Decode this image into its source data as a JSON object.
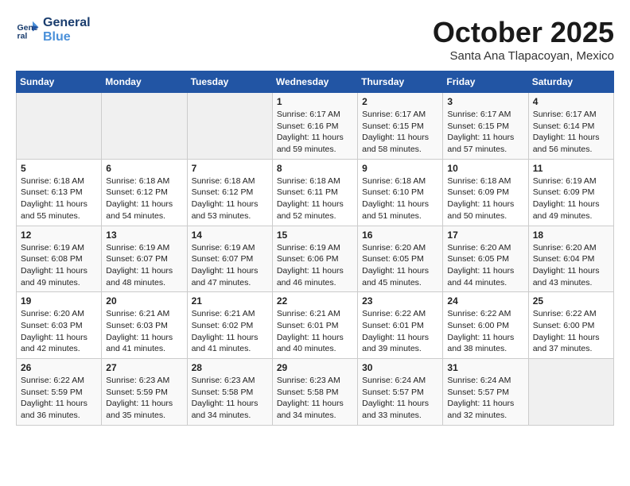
{
  "header": {
    "logo_line1": "General",
    "logo_line2": "Blue",
    "month": "October 2025",
    "location": "Santa Ana Tlapacoyan, Mexico"
  },
  "weekdays": [
    "Sunday",
    "Monday",
    "Tuesday",
    "Wednesday",
    "Thursday",
    "Friday",
    "Saturday"
  ],
  "weeks": [
    [
      {
        "day": "",
        "info": ""
      },
      {
        "day": "",
        "info": ""
      },
      {
        "day": "",
        "info": ""
      },
      {
        "day": "1",
        "info": "Sunrise: 6:17 AM\nSunset: 6:16 PM\nDaylight: 11 hours\nand 59 minutes."
      },
      {
        "day": "2",
        "info": "Sunrise: 6:17 AM\nSunset: 6:15 PM\nDaylight: 11 hours\nand 58 minutes."
      },
      {
        "day": "3",
        "info": "Sunrise: 6:17 AM\nSunset: 6:15 PM\nDaylight: 11 hours\nand 57 minutes."
      },
      {
        "day": "4",
        "info": "Sunrise: 6:17 AM\nSunset: 6:14 PM\nDaylight: 11 hours\nand 56 minutes."
      }
    ],
    [
      {
        "day": "5",
        "info": "Sunrise: 6:18 AM\nSunset: 6:13 PM\nDaylight: 11 hours\nand 55 minutes."
      },
      {
        "day": "6",
        "info": "Sunrise: 6:18 AM\nSunset: 6:12 PM\nDaylight: 11 hours\nand 54 minutes."
      },
      {
        "day": "7",
        "info": "Sunrise: 6:18 AM\nSunset: 6:12 PM\nDaylight: 11 hours\nand 53 minutes."
      },
      {
        "day": "8",
        "info": "Sunrise: 6:18 AM\nSunset: 6:11 PM\nDaylight: 11 hours\nand 52 minutes."
      },
      {
        "day": "9",
        "info": "Sunrise: 6:18 AM\nSunset: 6:10 PM\nDaylight: 11 hours\nand 51 minutes."
      },
      {
        "day": "10",
        "info": "Sunrise: 6:18 AM\nSunset: 6:09 PM\nDaylight: 11 hours\nand 50 minutes."
      },
      {
        "day": "11",
        "info": "Sunrise: 6:19 AM\nSunset: 6:09 PM\nDaylight: 11 hours\nand 49 minutes."
      }
    ],
    [
      {
        "day": "12",
        "info": "Sunrise: 6:19 AM\nSunset: 6:08 PM\nDaylight: 11 hours\nand 49 minutes."
      },
      {
        "day": "13",
        "info": "Sunrise: 6:19 AM\nSunset: 6:07 PM\nDaylight: 11 hours\nand 48 minutes."
      },
      {
        "day": "14",
        "info": "Sunrise: 6:19 AM\nSunset: 6:07 PM\nDaylight: 11 hours\nand 47 minutes."
      },
      {
        "day": "15",
        "info": "Sunrise: 6:19 AM\nSunset: 6:06 PM\nDaylight: 11 hours\nand 46 minutes."
      },
      {
        "day": "16",
        "info": "Sunrise: 6:20 AM\nSunset: 6:05 PM\nDaylight: 11 hours\nand 45 minutes."
      },
      {
        "day": "17",
        "info": "Sunrise: 6:20 AM\nSunset: 6:05 PM\nDaylight: 11 hours\nand 44 minutes."
      },
      {
        "day": "18",
        "info": "Sunrise: 6:20 AM\nSunset: 6:04 PM\nDaylight: 11 hours\nand 43 minutes."
      }
    ],
    [
      {
        "day": "19",
        "info": "Sunrise: 6:20 AM\nSunset: 6:03 PM\nDaylight: 11 hours\nand 42 minutes."
      },
      {
        "day": "20",
        "info": "Sunrise: 6:21 AM\nSunset: 6:03 PM\nDaylight: 11 hours\nand 41 minutes."
      },
      {
        "day": "21",
        "info": "Sunrise: 6:21 AM\nSunset: 6:02 PM\nDaylight: 11 hours\nand 41 minutes."
      },
      {
        "day": "22",
        "info": "Sunrise: 6:21 AM\nSunset: 6:01 PM\nDaylight: 11 hours\nand 40 minutes."
      },
      {
        "day": "23",
        "info": "Sunrise: 6:22 AM\nSunset: 6:01 PM\nDaylight: 11 hours\nand 39 minutes."
      },
      {
        "day": "24",
        "info": "Sunrise: 6:22 AM\nSunset: 6:00 PM\nDaylight: 11 hours\nand 38 minutes."
      },
      {
        "day": "25",
        "info": "Sunrise: 6:22 AM\nSunset: 6:00 PM\nDaylight: 11 hours\nand 37 minutes."
      }
    ],
    [
      {
        "day": "26",
        "info": "Sunrise: 6:22 AM\nSunset: 5:59 PM\nDaylight: 11 hours\nand 36 minutes."
      },
      {
        "day": "27",
        "info": "Sunrise: 6:23 AM\nSunset: 5:59 PM\nDaylight: 11 hours\nand 35 minutes."
      },
      {
        "day": "28",
        "info": "Sunrise: 6:23 AM\nSunset: 5:58 PM\nDaylight: 11 hours\nand 34 minutes."
      },
      {
        "day": "29",
        "info": "Sunrise: 6:23 AM\nSunset: 5:58 PM\nDaylight: 11 hours\nand 34 minutes."
      },
      {
        "day": "30",
        "info": "Sunrise: 6:24 AM\nSunset: 5:57 PM\nDaylight: 11 hours\nand 33 minutes."
      },
      {
        "day": "31",
        "info": "Sunrise: 6:24 AM\nSunset: 5:57 PM\nDaylight: 11 hours\nand 32 minutes."
      },
      {
        "day": "",
        "info": ""
      }
    ]
  ]
}
